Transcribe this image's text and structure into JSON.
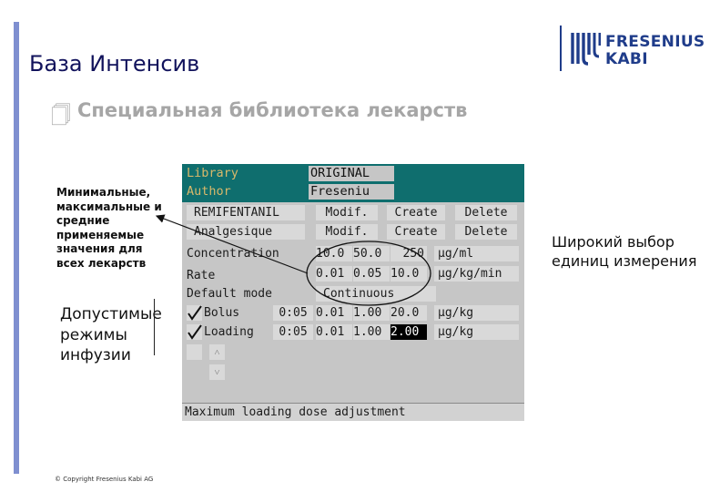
{
  "slide": {
    "title": "База Интенсив",
    "subtitle_icon": "document-icon",
    "subtitle": "Специальная библиотека лекарств",
    "accent_color": "#7f8fd0",
    "copyright": "© Copyright Fresenius Kabi AG"
  },
  "logo": {
    "line1": "FRESENIUS",
    "line2": "KABI",
    "color": "#1f3c8a"
  },
  "annotations": {
    "min_max": "Минимальные, максимальные и средние применяемые значения для всех лекарств",
    "modes": "Допустимые режимы инфузии",
    "units": "Широкий выбор единиц измерения"
  },
  "device": {
    "header_color": "#0f6e6e",
    "library_label": "Library",
    "library_value": "ORIGINAL",
    "author_label": "Author",
    "author_value": "Freseniu",
    "drug_name": "REMIFENTANIL",
    "drug_class": "Analgesique",
    "modif_label": "Modif.",
    "create_label": "Create",
    "delete_label": "Delete",
    "concentration": {
      "label": "Concentration",
      "min": "10.0",
      "mid": "50.0",
      "max": "250",
      "unit": "µg/ml"
    },
    "rate": {
      "label": "Rate",
      "min": "0.01",
      "mid": "0.05",
      "max": "10.0",
      "unit": "µg/kg/min"
    },
    "default_mode": {
      "label": "Default mode",
      "value": "Continuous"
    },
    "bolus": {
      "label": "Bolus",
      "time": "0:05",
      "min": "0.01",
      "mid": "1.00",
      "max": "20.0",
      "unit": "µg/kg",
      "checked": true
    },
    "loading": {
      "label": "Loading",
      "time": "0:05",
      "min": "0.01",
      "mid": "1.00",
      "max": "2.00",
      "unit": "µg/kg",
      "checked": true
    },
    "empty_row": {
      "checked": false
    },
    "scroll_up_icon": "chevron-up-icon",
    "scroll_down_icon": "chevron-down-icon",
    "status": "Maximum loading dose adjustment"
  }
}
